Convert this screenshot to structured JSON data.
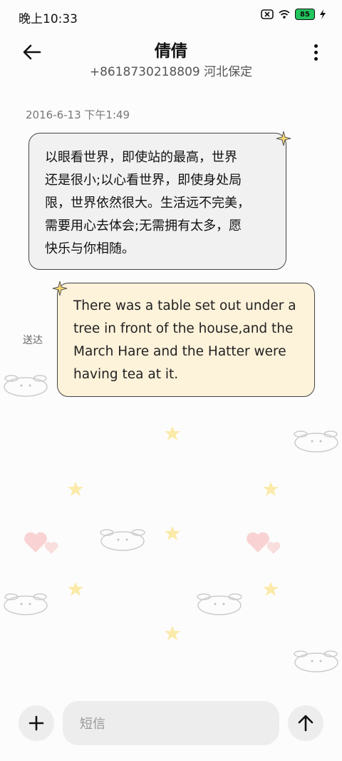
{
  "status_bar": {
    "time": "晚上10:33",
    "battery_level": "85",
    "icons": [
      "no-sim-icon",
      "wifi-icon",
      "battery-icon",
      "charging-icon"
    ]
  },
  "header": {
    "contact_name": "倩倩",
    "contact_detail": "+8618730218809 河北保定",
    "icons": [
      "back-arrow-icon",
      "more-vertical-icon"
    ]
  },
  "conversation": {
    "timestamp": "2016-6-13 下午1:49",
    "messages": [
      {
        "direction": "incoming",
        "lines": [
          "以眼看世界，即使站的最高，世界",
          "还是很小;以心看世界，即使身处局",
          "限，世界依然很大。生活远不完美，",
          "需要用心去体会;无需拥有太多，愿",
          "快乐与你相随。"
        ]
      },
      {
        "direction": "outgoing",
        "lines": [
          "There was a table set out under a",
          "tree in front of the house,and the",
          "March Hare and the Hatter were",
          "having tea at it."
        ],
        "status": "送达"
      }
    ]
  },
  "composer": {
    "placeholder": "短信",
    "icons": [
      "plus-icon",
      "send-arrow-icon"
    ]
  },
  "colors": {
    "incoming_bubble": "#f1f1f1",
    "outgoing_bubble": "#fdf2da",
    "battery": "#22c55e"
  }
}
